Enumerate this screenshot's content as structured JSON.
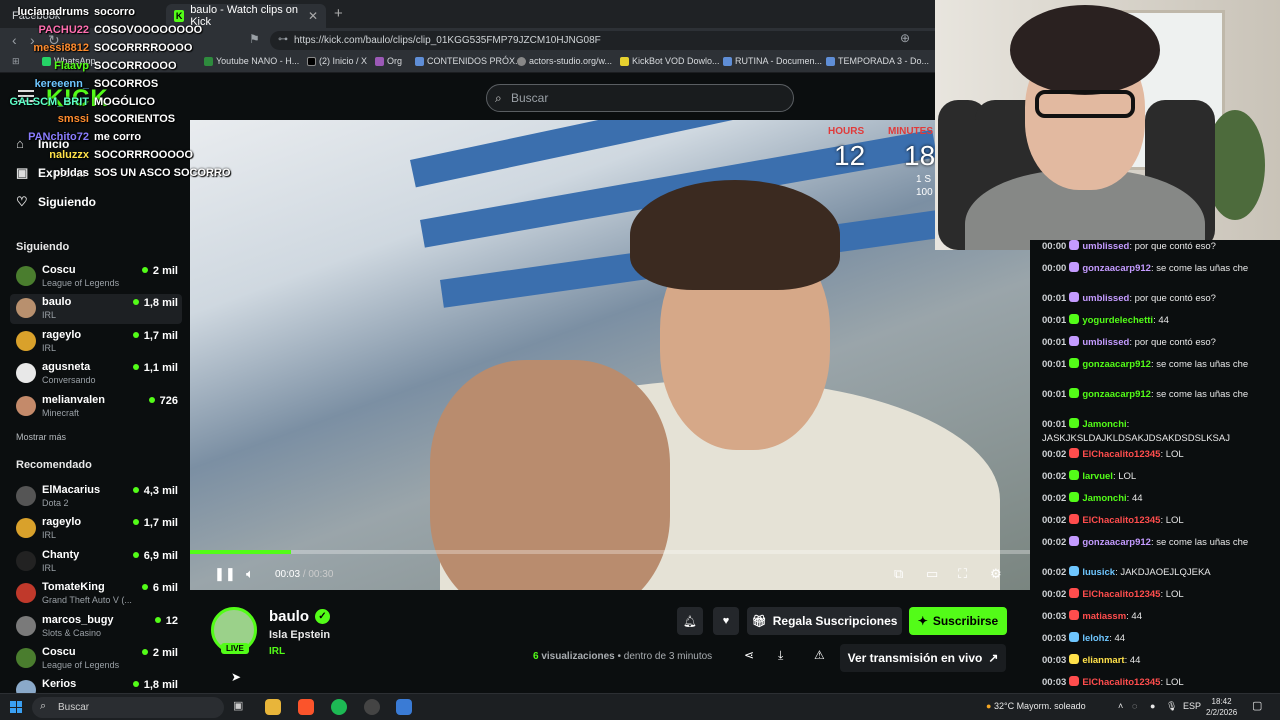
{
  "browser": {
    "tabs": [
      {
        "label": "Facebook"
      },
      {
        "label": "baulo - Watch clips on Kick"
      }
    ],
    "url": "https://kick.com/baulo/clips/clip_01KGG535FMP79JZCM10HJNG08F",
    "bookmarks": [
      "WhatsApp",
      "Youtube NANO - H...",
      "(2) Inicio / X",
      "Org",
      "CONTENIDOS PRÓX...",
      "actors-studio.org/w...",
      "KickBot VOD Dowlo...",
      "RUTINA - Documen...",
      "TEMPORADA 3 - Do..."
    ]
  },
  "overlay_chat": [
    {
      "user": "lucianadrums",
      "msg": "socorro",
      "color": "#ffffff"
    },
    {
      "user": "PACHU22",
      "msg": "COSOVOOOOOOOO",
      "color": "#ff6fb0"
    },
    {
      "user": "messi8812",
      "msg": "SOCORRRROOOO",
      "color": "#ff8c2e"
    },
    {
      "user": "Flaavp",
      "msg": "SOCORROOOO",
      "color": "#53fc18"
    },
    {
      "user": "kereeenn_",
      "msg": "SOCORROS",
      "color": "#6ec6ff"
    },
    {
      "user": "GALSCM_BRIT",
      "msg": "MOGÓLICO",
      "color": "#5effc8"
    },
    {
      "user": "smssi",
      "msg": "SOCORIENTOS",
      "color": "#ff8c2e"
    },
    {
      "user": "PANchito72",
      "msg": "me corro",
      "color": "#8a7dff"
    },
    {
      "user": "naluzzx",
      "msg": "SOCORRROOOOO",
      "color": "#ffe14a"
    },
    {
      "user": "poldas",
      "msg": "SOS UN ASCO SOCORRO",
      "color": "#ffffff"
    }
  ],
  "header": {
    "logo": "KICK",
    "search_placeholder": "Buscar"
  },
  "nav": [
    {
      "label": "Inicio",
      "icon": "home-icon"
    },
    {
      "label": "Explorar",
      "icon": "compass-icon"
    },
    {
      "label": "Siguiendo",
      "icon": "heart-icon"
    }
  ],
  "sidebar": {
    "following_title": "Siguiendo",
    "following": [
      {
        "name": "Coscu",
        "cat": "League of Legends",
        "views": "2 mil",
        "color": "#4a7d2e"
      },
      {
        "name": "baulo",
        "cat": "IRL",
        "views": "1,8 mil",
        "color": "#b8906e"
      },
      {
        "name": "rageylo",
        "cat": "IRL",
        "views": "1,7 mil",
        "color": "#d9a12b"
      },
      {
        "name": "agusneta",
        "cat": "Conversando",
        "views": "1,1 mil",
        "color": "#e8e8e8"
      },
      {
        "name": "melianvalen",
        "cat": "Minecraft",
        "views": "726",
        "color": "#c48a6a"
      }
    ],
    "show_more": "Mostrar más",
    "recommended_title": "Recomendado",
    "recommended": [
      {
        "name": "ElMacarius",
        "cat": "Dota 2",
        "views": "4,3 mil",
        "color": "#555555"
      },
      {
        "name": "rageylo",
        "cat": "IRL",
        "views": "1,7 mil",
        "color": "#d9a12b"
      },
      {
        "name": "Chanty",
        "cat": "IRL",
        "views": "6,9 mil",
        "color": "#222222"
      },
      {
        "name": "TomateKing",
        "cat": "Grand Theft Auto V (...",
        "views": "6 mil",
        "color": "#c0392b"
      },
      {
        "name": "marcos_bugy",
        "cat": "Slots & Casino",
        "views": "12",
        "color": "#7a7a7a"
      },
      {
        "name": "Coscu",
        "cat": "League of Legends",
        "views": "2 mil",
        "color": "#4a7d2e"
      },
      {
        "name": "Kerios",
        "cat": "",
        "views": "1,8 mil",
        "color": "#8aa9c9"
      }
    ]
  },
  "video": {
    "timer": {
      "hours_label": "HOURS",
      "minutes_label": "MINUTES",
      "hours": "12",
      "minutes": "18",
      "extra1": "1 S",
      "extra2": "100"
    },
    "current_time": "00:03",
    "separator": "/",
    "duration": "00:30",
    "progress": 0.12
  },
  "channel": {
    "name": "baulo",
    "live_badge": "LIVE",
    "title": "Isla Epstein",
    "category": "IRL",
    "views_count": "6",
    "views_label": "visualizaciones",
    "time_info": "• dentro de 3 minutos",
    "gift_label": "Regala Suscripciones",
    "subscribe_label": "Suscribirse",
    "watch_live_label": "Ver transmisión en vivo"
  },
  "chat": [
    {
      "ts": "00:00",
      "user": "umblissed",
      "msg": ": por que contó eso?",
      "color": "#c49bff"
    },
    {
      "ts": "00:00",
      "user": "gonzaacarp912",
      "msg": ": se come las uñas che",
      "color": "#c49bff"
    },
    {
      "ts": "00:01",
      "user": "umblissed",
      "msg": ": por que contó eso?",
      "color": "#c49bff"
    },
    {
      "ts": "00:01",
      "user": "yogurdelechetti",
      "msg": ": 44",
      "color": "#53fc18"
    },
    {
      "ts": "00:01",
      "user": "umblissed",
      "msg": ": por que contó eso?",
      "color": "#c49bff"
    },
    {
      "ts": "00:01",
      "user": "gonzaacarp912",
      "msg": ": se come las uñas che",
      "color": "#53fc18"
    },
    {
      "ts": "00:01",
      "user": "gonzaacarp912",
      "msg": ": se come las uñas che",
      "color": "#53fc18"
    },
    {
      "ts": "00:01",
      "user": "Jamonchi",
      "msg": ": JASKJKSLDAJKLDSAKJDSAKDSDSLKSAJ",
      "color": "#53fc18"
    },
    {
      "ts": "00:02",
      "user": "ElChacalito12345",
      "msg": ": LOL",
      "color": "#ff4d4d"
    },
    {
      "ts": "00:02",
      "user": "larvuel",
      "msg": ": LOL",
      "color": "#53fc18"
    },
    {
      "ts": "00:02",
      "user": "Jamonchi",
      "msg": ": 44",
      "color": "#53fc18"
    },
    {
      "ts": "00:02",
      "user": "ElChacalito12345",
      "msg": ": LOL",
      "color": "#ff4d4d"
    },
    {
      "ts": "00:02",
      "user": "gonzaacarp912",
      "msg": ": se come las uñas che",
      "color": "#c49bff"
    },
    {
      "ts": "00:02",
      "user": "luusick",
      "msg": ": JAKDJAOEJLQJEKA",
      "color": "#6ec6ff"
    },
    {
      "ts": "00:02",
      "user": "ElChacalito12345",
      "msg": ": LOL",
      "color": "#ff4d4d"
    },
    {
      "ts": "00:03",
      "user": "matiassm",
      "msg": ": 44",
      "color": "#ff4d4d"
    },
    {
      "ts": "00:03",
      "user": "lelohz",
      "msg": ": 44",
      "color": "#6ec6ff"
    },
    {
      "ts": "00:03",
      "user": "elianmart",
      "msg": ": 44",
      "color": "#ffe14a"
    },
    {
      "ts": "00:03",
      "user": "ElChacalito12345",
      "msg": ": LOL",
      "color": "#ff4d4d"
    }
  ],
  "taskbar": {
    "search": "Buscar",
    "weather": "32°C  Mayorm. soleado",
    "lang": "ESP",
    "time": "18:42",
    "date": "2/2/2026"
  },
  "colors": {
    "kick_green": "#53fc18",
    "bg": "#0b0e0f"
  }
}
